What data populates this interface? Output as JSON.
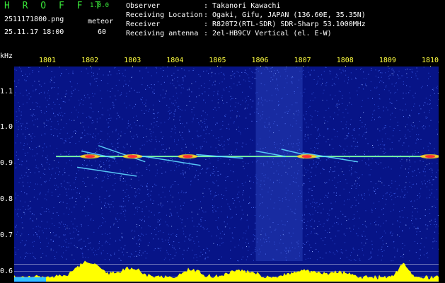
{
  "app": {
    "title": "H R O F F T",
    "version": "1.0.0",
    "file_name": "2511171800.png",
    "date_time": "25.11.17 18:00",
    "mode_label": "meteor",
    "mode_count": "60"
  },
  "info": [
    {
      "label": "Observer",
      "value": ": Takanori Kawachi"
    },
    {
      "label": "Receiving Location",
      "value": ": Ogaki, Gifu, JAPAN (136.60E, 35.35N)"
    },
    {
      "label": "Receiver",
      "value": ": R820T2(RTL-SDR) SDR-Sharp 53.1000MHz"
    },
    {
      "label": "Receiving antenna",
      "value": ": 2el-HB9CV Vertical (el. E-W)"
    }
  ],
  "colors": {
    "background": "#071487",
    "tick_x": "#ffff40",
    "title_green": "#39e639",
    "signal_line": "#40e0ff",
    "histogram": "#ffff00"
  },
  "chart_data": {
    "type": "heatmap",
    "xlabel": "",
    "ylabel": "kHz",
    "x_ticks": [
      "1801",
      "1802",
      "1803",
      "1804",
      "1805",
      "1806",
      "1807",
      "1808",
      "1809",
      "1810"
    ],
    "y_ticks": [
      "1.1",
      "1.0",
      "0.9",
      "0.8",
      "0.7",
      "0.6"
    ],
    "y_unit": "kHz",
    "ylim": [
      0.57,
      1.17
    ],
    "carrier_frequency_khz": 0.92,
    "meteor_traces": [
      {
        "x_start": 1801.8,
        "x_end": 1802.6,
        "f_start": 0.935,
        "f_end": 0.915
      },
      {
        "x_start": 1802.2,
        "x_end": 1803.3,
        "f_start": 0.95,
        "f_end": 0.905
      },
      {
        "x_start": 1801.7,
        "x_end": 1803.1,
        "f_start": 0.89,
        "f_end": 0.865
      },
      {
        "x_start": 1803.0,
        "x_end": 1804.6,
        "f_start": 0.925,
        "f_end": 0.895
      },
      {
        "x_start": 1804.5,
        "x_end": 1805.6,
        "f_start": 0.925,
        "f_end": 0.915
      },
      {
        "x_start": 1805.9,
        "x_end": 1806.6,
        "f_start": 0.935,
        "f_end": 0.92
      },
      {
        "x_start": 1806.5,
        "x_end": 1807.4,
        "f_start": 0.94,
        "f_end": 0.915
      },
      {
        "x_start": 1807.0,
        "x_end": 1808.3,
        "f_start": 0.93,
        "f_end": 0.905
      }
    ],
    "hotspots": [
      1802.0,
      1803.0,
      1804.3,
      1807.1,
      1810.0
    ]
  }
}
